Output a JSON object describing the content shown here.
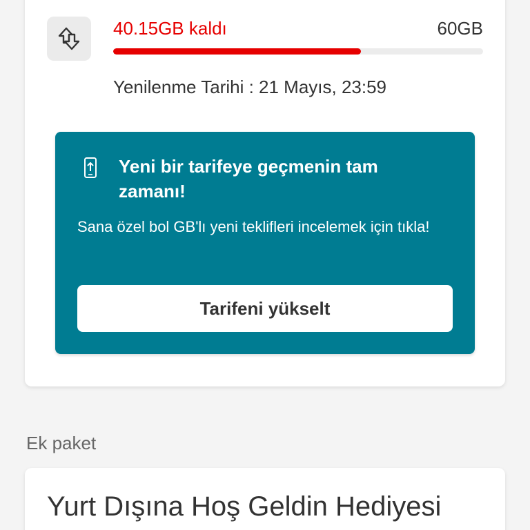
{
  "usage": {
    "icon": "data-transfer-arrows-icon",
    "remaining_label": "40.15GB kaldı",
    "total_label": "60GB",
    "progress_fraction": 0.67,
    "renewal_text": "Yenilenme Tarihi : 21 Mayıs, 23:59"
  },
  "promo": {
    "icon": "phone-upgrade-icon",
    "title": "Yeni bir tarifeye geçmenin tam zamanı!",
    "description": "Sana özel bol GB'lı yeni teklifleri incelemek için tıkla!",
    "button_label": "Tarifeni yükselt"
  },
  "addon_section": {
    "title": "Ek paket",
    "package_name": "Yurt Dışına Hoş Geldin Hediyesi"
  },
  "colors": {
    "brand_red": "#e60000",
    "promo_teal": "#007c92",
    "background": "#f4f4f4"
  }
}
